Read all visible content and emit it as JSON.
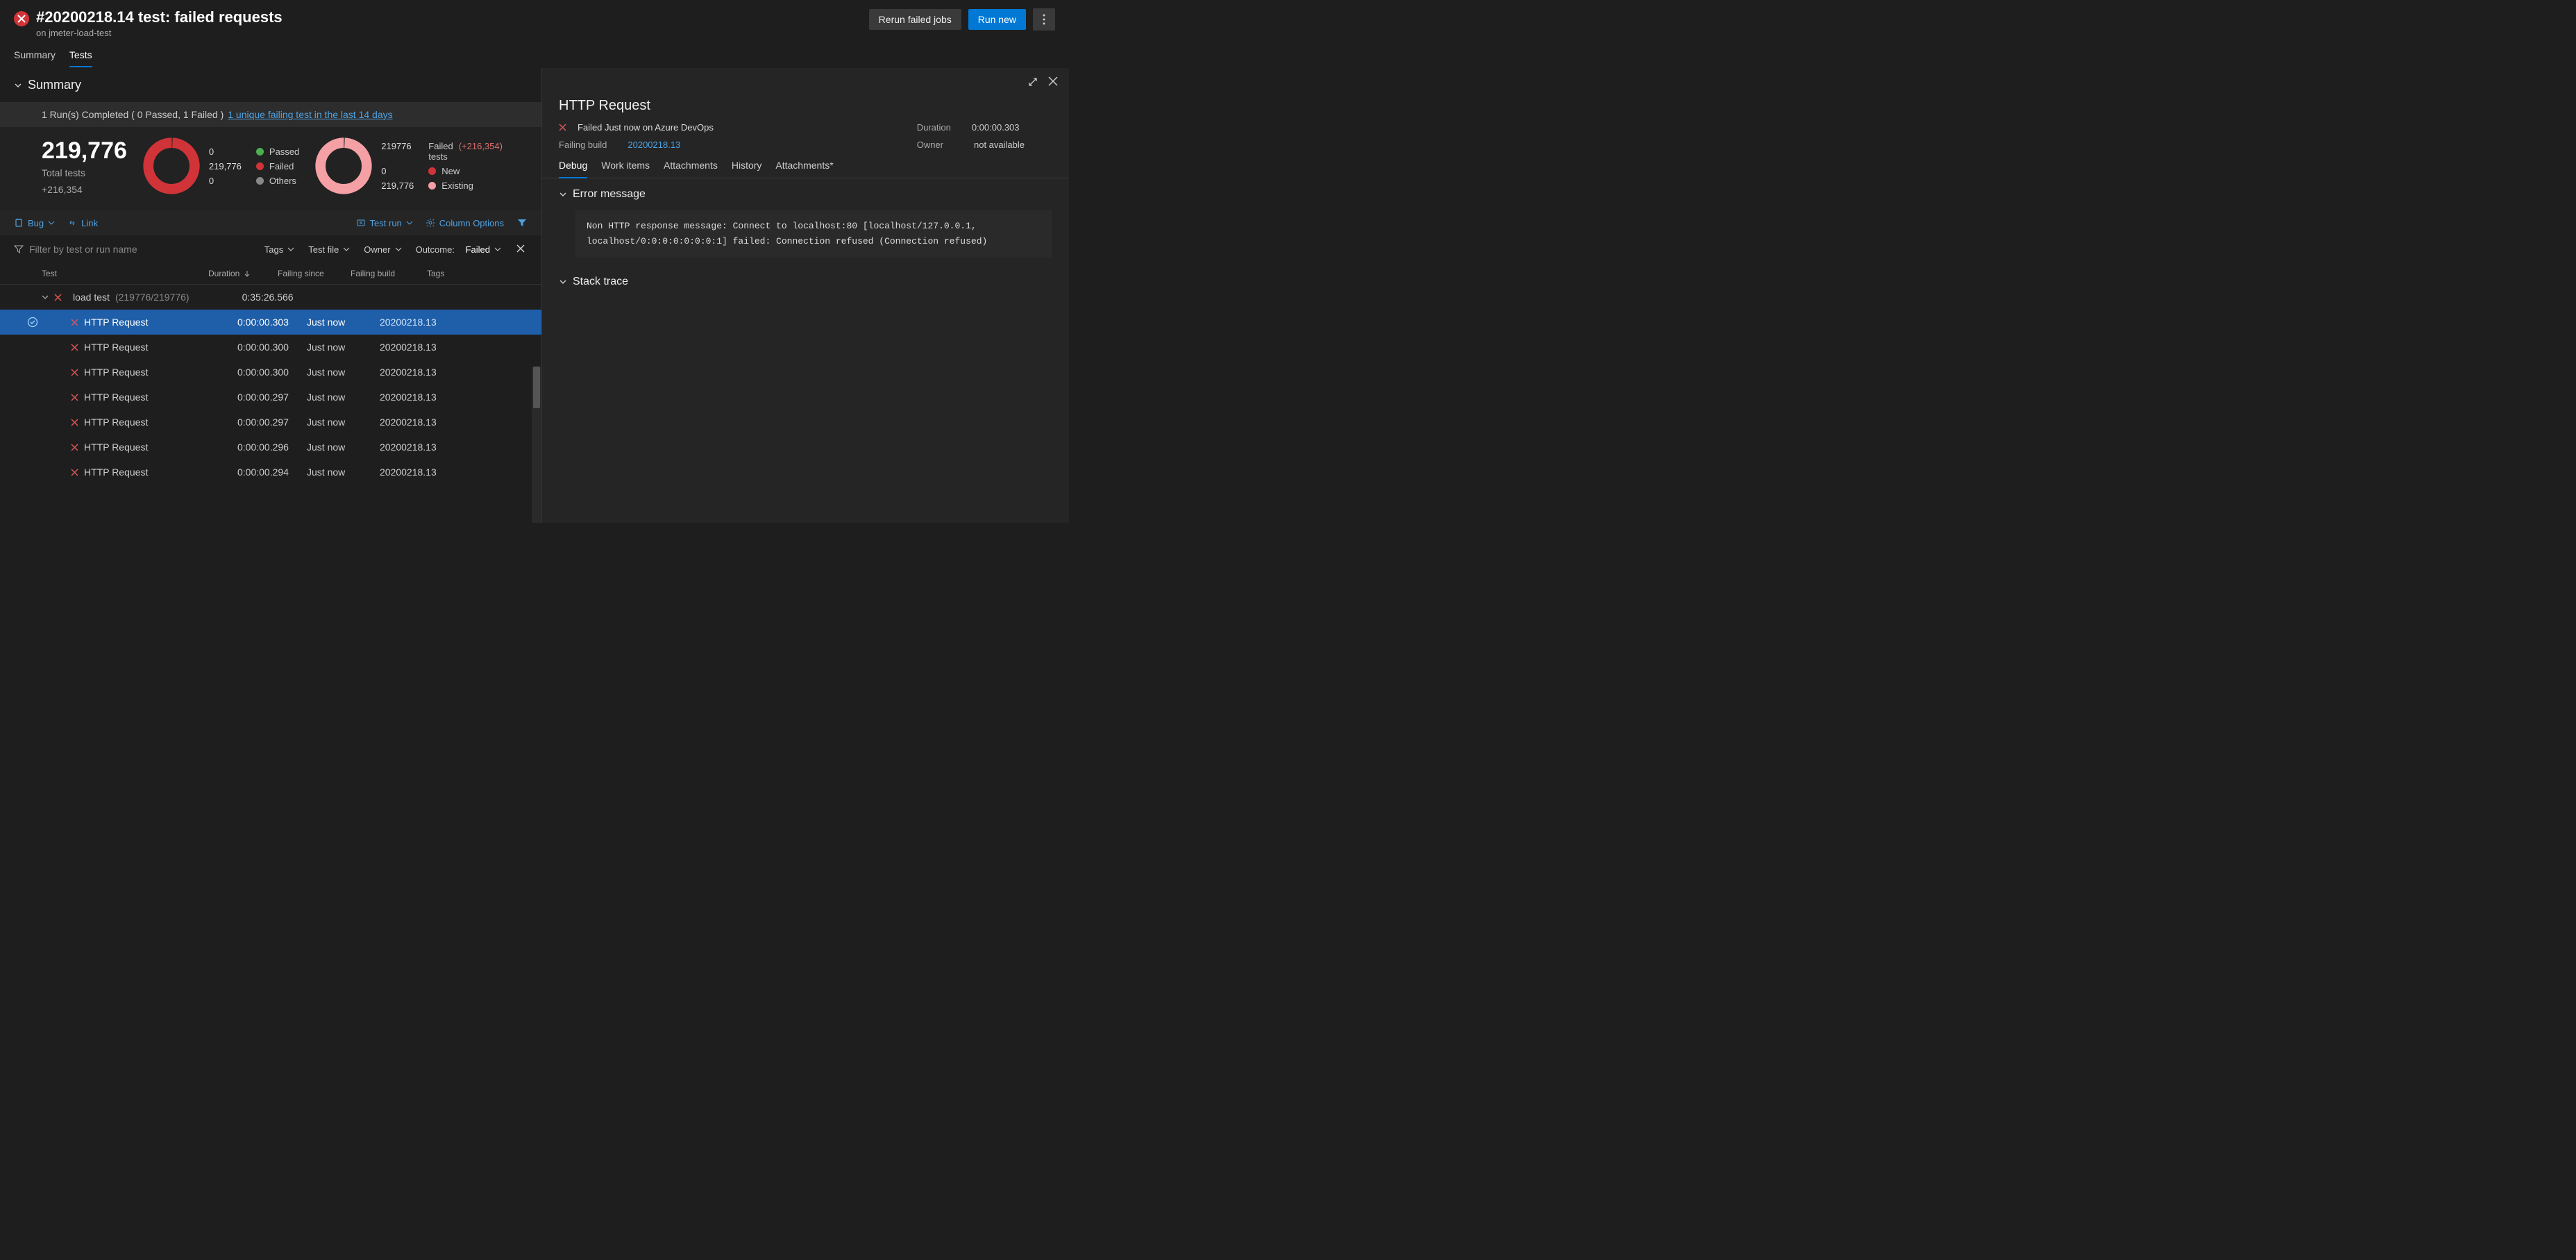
{
  "header": {
    "title": "#20200218.14 test: failed requests",
    "subtitle": "on jmeter-load-test",
    "rerun_btn": "Rerun failed jobs",
    "run_btn": "Run new"
  },
  "tabs": {
    "summary": "Summary",
    "tests": "Tests"
  },
  "summary_section": {
    "heading": "Summary",
    "strip_text": "1 Run(s) Completed ( 0 Passed, 1 Failed )",
    "strip_link": "1 unique failing test in the last 14 days",
    "total_tests_value": "219,776",
    "total_tests_label": "Total tests",
    "delta": "+216,354",
    "legend1": {
      "passed_n": "0",
      "passed_l": "Passed",
      "failed_n": "219,776",
      "failed_l": "Failed",
      "others_n": "0",
      "others_l": "Others"
    },
    "failed_head_n": "219776",
    "failed_head_l": "Failed",
    "failed_head_delta": "(+216,354)",
    "failed_sub": "tests",
    "legend2": {
      "new_n": "0",
      "new_l": "New",
      "existing_n": "219,776",
      "existing_l": "Existing"
    }
  },
  "toolbar": {
    "bug": "Bug",
    "link": "Link",
    "testrun": "Test run",
    "coloptions": "Column Options"
  },
  "filters": {
    "placeholder": "Filter by test or run name",
    "tags": "Tags",
    "testfile": "Test file",
    "owner": "Owner",
    "outcome_label": "Outcome:",
    "outcome_value": "Failed"
  },
  "columns": {
    "test": "Test",
    "duration": "Duration",
    "failing_since": "Failing since",
    "failing_build": "Failing build",
    "tags": "Tags"
  },
  "group": {
    "name": "load test",
    "count": "(219776/219776)",
    "duration": "0:35:26.566"
  },
  "rows": [
    {
      "name": "HTTP Request",
      "duration": "0:00:00.303",
      "since": "Just now",
      "build": "20200218.13",
      "selected": true
    },
    {
      "name": "HTTP Request",
      "duration": "0:00:00.300",
      "since": "Just now",
      "build": "20200218.13",
      "selected": false
    },
    {
      "name": "HTTP Request",
      "duration": "0:00:00.300",
      "since": "Just now",
      "build": "20200218.13",
      "selected": false
    },
    {
      "name": "HTTP Request",
      "duration": "0:00:00.297",
      "since": "Just now",
      "build": "20200218.13",
      "selected": false
    },
    {
      "name": "HTTP Request",
      "duration": "0:00:00.297",
      "since": "Just now",
      "build": "20200218.13",
      "selected": false
    },
    {
      "name": "HTTP Request",
      "duration": "0:00:00.296",
      "since": "Just now",
      "build": "20200218.13",
      "selected": false
    },
    {
      "name": "HTTP Request",
      "duration": "0:00:00.294",
      "since": "Just now",
      "build": "20200218.13",
      "selected": false
    }
  ],
  "detail": {
    "title": "HTTP Request",
    "status": "Failed Just now on Azure DevOps",
    "failing_build_label": "Failing build",
    "failing_build_value": "20200218.13",
    "duration_label": "Duration",
    "duration_value": "0:00:00.303",
    "owner_label": "Owner",
    "owner_value": "not available",
    "tabs": [
      "Debug",
      "Work items",
      "Attachments",
      "History",
      "Attachments*"
    ],
    "error_heading": "Error message",
    "error_body": "Non HTTP response message: Connect to localhost:80 [localhost/127.0.0.1, localhost/0:0:0:0:0:0:0:1] failed: Connection refused (Connection refused)",
    "stack_heading": "Stack trace"
  },
  "chart_data": [
    {
      "type": "pie",
      "title": "Outcome",
      "series": [
        {
          "name": "Passed",
          "value": 0,
          "color": "#4caf50"
        },
        {
          "name": "Failed",
          "value": 219776,
          "color": "#d13438"
        },
        {
          "name": "Others",
          "value": 0,
          "color": "#888888"
        }
      ]
    },
    {
      "type": "pie",
      "title": "Failed tests",
      "series": [
        {
          "name": "New",
          "value": 0,
          "color": "#d13438"
        },
        {
          "name": "Existing",
          "value": 219776,
          "color": "#f4a0a4"
        }
      ]
    }
  ]
}
